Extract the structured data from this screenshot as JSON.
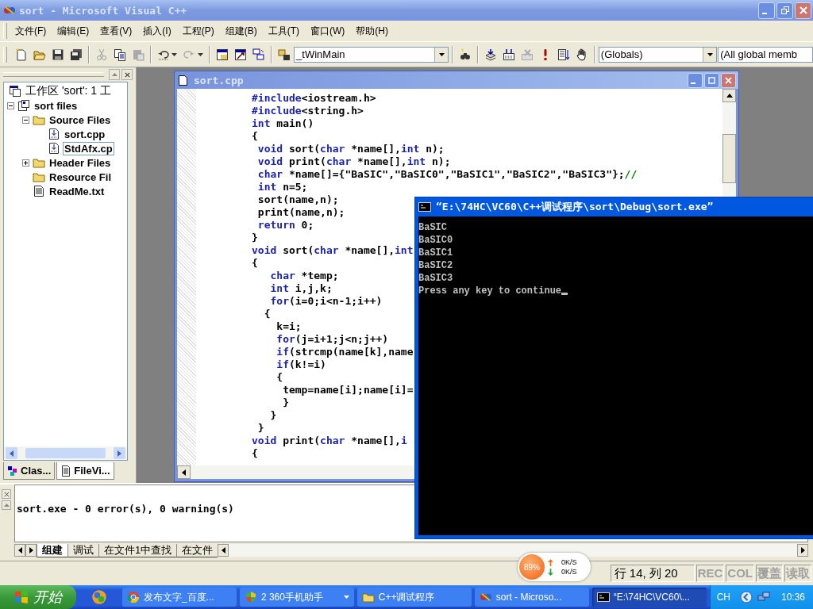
{
  "window": {
    "title": "sort - Microsoft Visual C++"
  },
  "menu": [
    "文件(F)",
    "编辑(E)",
    "查看(V)",
    "插入(I)",
    "工程(P)",
    "组建(B)",
    "工具(T)",
    "窗口(W)",
    "帮助(H)"
  ],
  "toolbar": {
    "function_combo": "_tWinMain",
    "scope_combo": "(Globals)",
    "members_combo": "(All global memb"
  },
  "workspace": {
    "root": "工作区 'sort': 1 工",
    "tree": [
      {
        "label": "sort files",
        "kind": "project",
        "expanded": true,
        "selected": false,
        "children": [
          {
            "label": "Source Files",
            "kind": "folder",
            "expanded": true,
            "selected": false,
            "children": [
              {
                "label": "sort.cpp",
                "kind": "source",
                "selected": false
              },
              {
                "label": "StdAfx.cp",
                "kind": "source",
                "selected": true
              }
            ]
          },
          {
            "label": "Header Files",
            "kind": "folder",
            "expanded": false,
            "selected": false
          },
          {
            "label": "Resource Fil",
            "kind": "folder",
            "selected": false
          },
          {
            "label": "ReadMe.txt",
            "kind": "text",
            "selected": false
          }
        ]
      }
    ],
    "tabs": [
      {
        "label": "Clas...",
        "kind": "classes",
        "selected": false
      },
      {
        "label": "FileVi...",
        "kind": "files",
        "selected": true
      }
    ]
  },
  "editor": {
    "title": "sort.cpp",
    "lines": [
      [
        {
          "kind": "keyword",
          "text": "#include"
        },
        {
          "kind": "plain",
          "text": "<iostream.h>"
        }
      ],
      [
        {
          "kind": "keyword",
          "text": "#include"
        },
        {
          "kind": "plain",
          "text": "<string.h>"
        }
      ],
      [
        {
          "kind": "keyword",
          "text": "int"
        },
        {
          "kind": "plain",
          "text": " main()"
        }
      ],
      [
        {
          "kind": "plain",
          "text": "{"
        }
      ],
      [
        {
          "kind": "keyword",
          "text": " void"
        },
        {
          "kind": "plain",
          "text": " sort("
        },
        {
          "kind": "keyword",
          "text": "char"
        },
        {
          "kind": "plain",
          "text": " *name[],"
        },
        {
          "kind": "keyword",
          "text": "int"
        },
        {
          "kind": "plain",
          "text": " n);"
        }
      ],
      [
        {
          "kind": "keyword",
          "text": " void"
        },
        {
          "kind": "plain",
          "text": " print("
        },
        {
          "kind": "keyword",
          "text": "char"
        },
        {
          "kind": "plain",
          "text": " *name[],"
        },
        {
          "kind": "keyword",
          "text": "int"
        },
        {
          "kind": "plain",
          "text": " n);"
        }
      ],
      [
        {
          "kind": "keyword",
          "text": " char"
        },
        {
          "kind": "plain",
          "text": " *name[]={\"BaSIC\",\"BaSIC0\",\"BaSIC1\",\"BaSIC2\",\"BaSIC3\"};"
        },
        {
          "kind": "comment",
          "text": "//"
        }
      ],
      [
        {
          "kind": "keyword",
          "text": " int"
        },
        {
          "kind": "plain",
          "text": " n=5;"
        }
      ],
      [
        {
          "kind": "plain",
          "text": " sort(name,n);"
        }
      ],
      [
        {
          "kind": "plain",
          "text": " print(name,n);"
        }
      ],
      [
        {
          "kind": "keyword",
          "text": " return"
        },
        {
          "kind": "plain",
          "text": " 0;"
        }
      ],
      [
        {
          "kind": "plain",
          "text": "}"
        }
      ],
      [
        {
          "kind": "keyword",
          "text": "void"
        },
        {
          "kind": "plain",
          "text": " sort("
        },
        {
          "kind": "keyword",
          "text": "char"
        },
        {
          "kind": "plain",
          "text": " *name[],"
        },
        {
          "kind": "keyword",
          "text": "int"
        }
      ],
      [
        {
          "kind": "plain",
          "text": "{"
        }
      ],
      [
        {
          "kind": "keyword",
          "text": "   char"
        },
        {
          "kind": "plain",
          "text": " *temp;"
        }
      ],
      [
        {
          "kind": "keyword",
          "text": "   int"
        },
        {
          "kind": "plain",
          "text": " i,j,k;"
        }
      ],
      [
        {
          "kind": "keyword",
          "text": "   for"
        },
        {
          "kind": "plain",
          "text": "(i=0;i<n-1;i++)"
        }
      ],
      [
        {
          "kind": "plain",
          "text": "  {"
        }
      ],
      [
        {
          "kind": "plain",
          "text": "    k=i;"
        }
      ],
      [
        {
          "kind": "keyword",
          "text": "    for"
        },
        {
          "kind": "plain",
          "text": "(j=i+1;j<n;j++)"
        }
      ],
      [
        {
          "kind": "keyword",
          "text": "    if"
        },
        {
          "kind": "plain",
          "text": "(strcmp(name[k],name"
        }
      ],
      [
        {
          "kind": "keyword",
          "text": "    if"
        },
        {
          "kind": "plain",
          "text": "(k!=i)"
        }
      ],
      [
        {
          "kind": "plain",
          "text": "    {"
        }
      ],
      [
        {
          "kind": "plain",
          "text": "     temp=name[i];name[i]="
        }
      ],
      [
        {
          "kind": "plain",
          "text": "     }"
        }
      ],
      [
        {
          "kind": "plain",
          "text": "   }"
        }
      ],
      [
        {
          "kind": "plain",
          "text": " }"
        }
      ],
      [
        {
          "kind": "keyword",
          "text": "void"
        },
        {
          "kind": "plain",
          "text": " print("
        },
        {
          "kind": "keyword",
          "text": "char"
        },
        {
          "kind": "plain",
          "text": " *name[],"
        },
        {
          "kind": "keyword",
          "text": "i"
        }
      ],
      [
        {
          "kind": "plain",
          "text": "{"
        }
      ]
    ]
  },
  "console": {
    "title": "“E:\\74HC\\VC60\\C++调试程序\\sort\\Debug\\sort.exe”",
    "lines": [
      "BaSIC",
      "BaSIC0",
      "BaSIC1",
      "BaSIC2",
      "BaSIC3",
      "Press any key to continue"
    ]
  },
  "output": {
    "text": "sort.exe - 0 error(s), 0 warning(s)",
    "tabs": [
      {
        "label": "组建",
        "selected": true
      },
      {
        "label": "调试",
        "selected": false
      },
      {
        "label": "在文件1中查找",
        "selected": false
      },
      {
        "label": "在文件",
        "selected": false
      }
    ]
  },
  "net_monitor": {
    "load": "89%",
    "upload": "0K/S",
    "download": "0K/S"
  },
  "status_bar": {
    "position": "行 14, 列 20",
    "indicators": [
      {
        "label": "REC",
        "on": false
      },
      {
        "label": "COL",
        "on": false
      },
      {
        "label": "覆盖",
        "on": false
      },
      {
        "label": "读取",
        "on": false
      }
    ]
  },
  "taskbar": {
    "start": "开始",
    "tasks": [
      {
        "label": "发布文字_百度...",
        "kind": "browser",
        "selected": false
      },
      {
        "label": "2 360手机助手",
        "kind": "group",
        "selected": false
      },
      {
        "label": "C++调试程序",
        "kind": "folder",
        "selected": false
      },
      {
        "label": "sort - Microso...",
        "kind": "ide",
        "selected": false
      },
      {
        "label": "“E:\\74HC\\VC60\\...",
        "kind": "console",
        "selected": true
      }
    ],
    "language": "CH",
    "clock": "10:36"
  }
}
